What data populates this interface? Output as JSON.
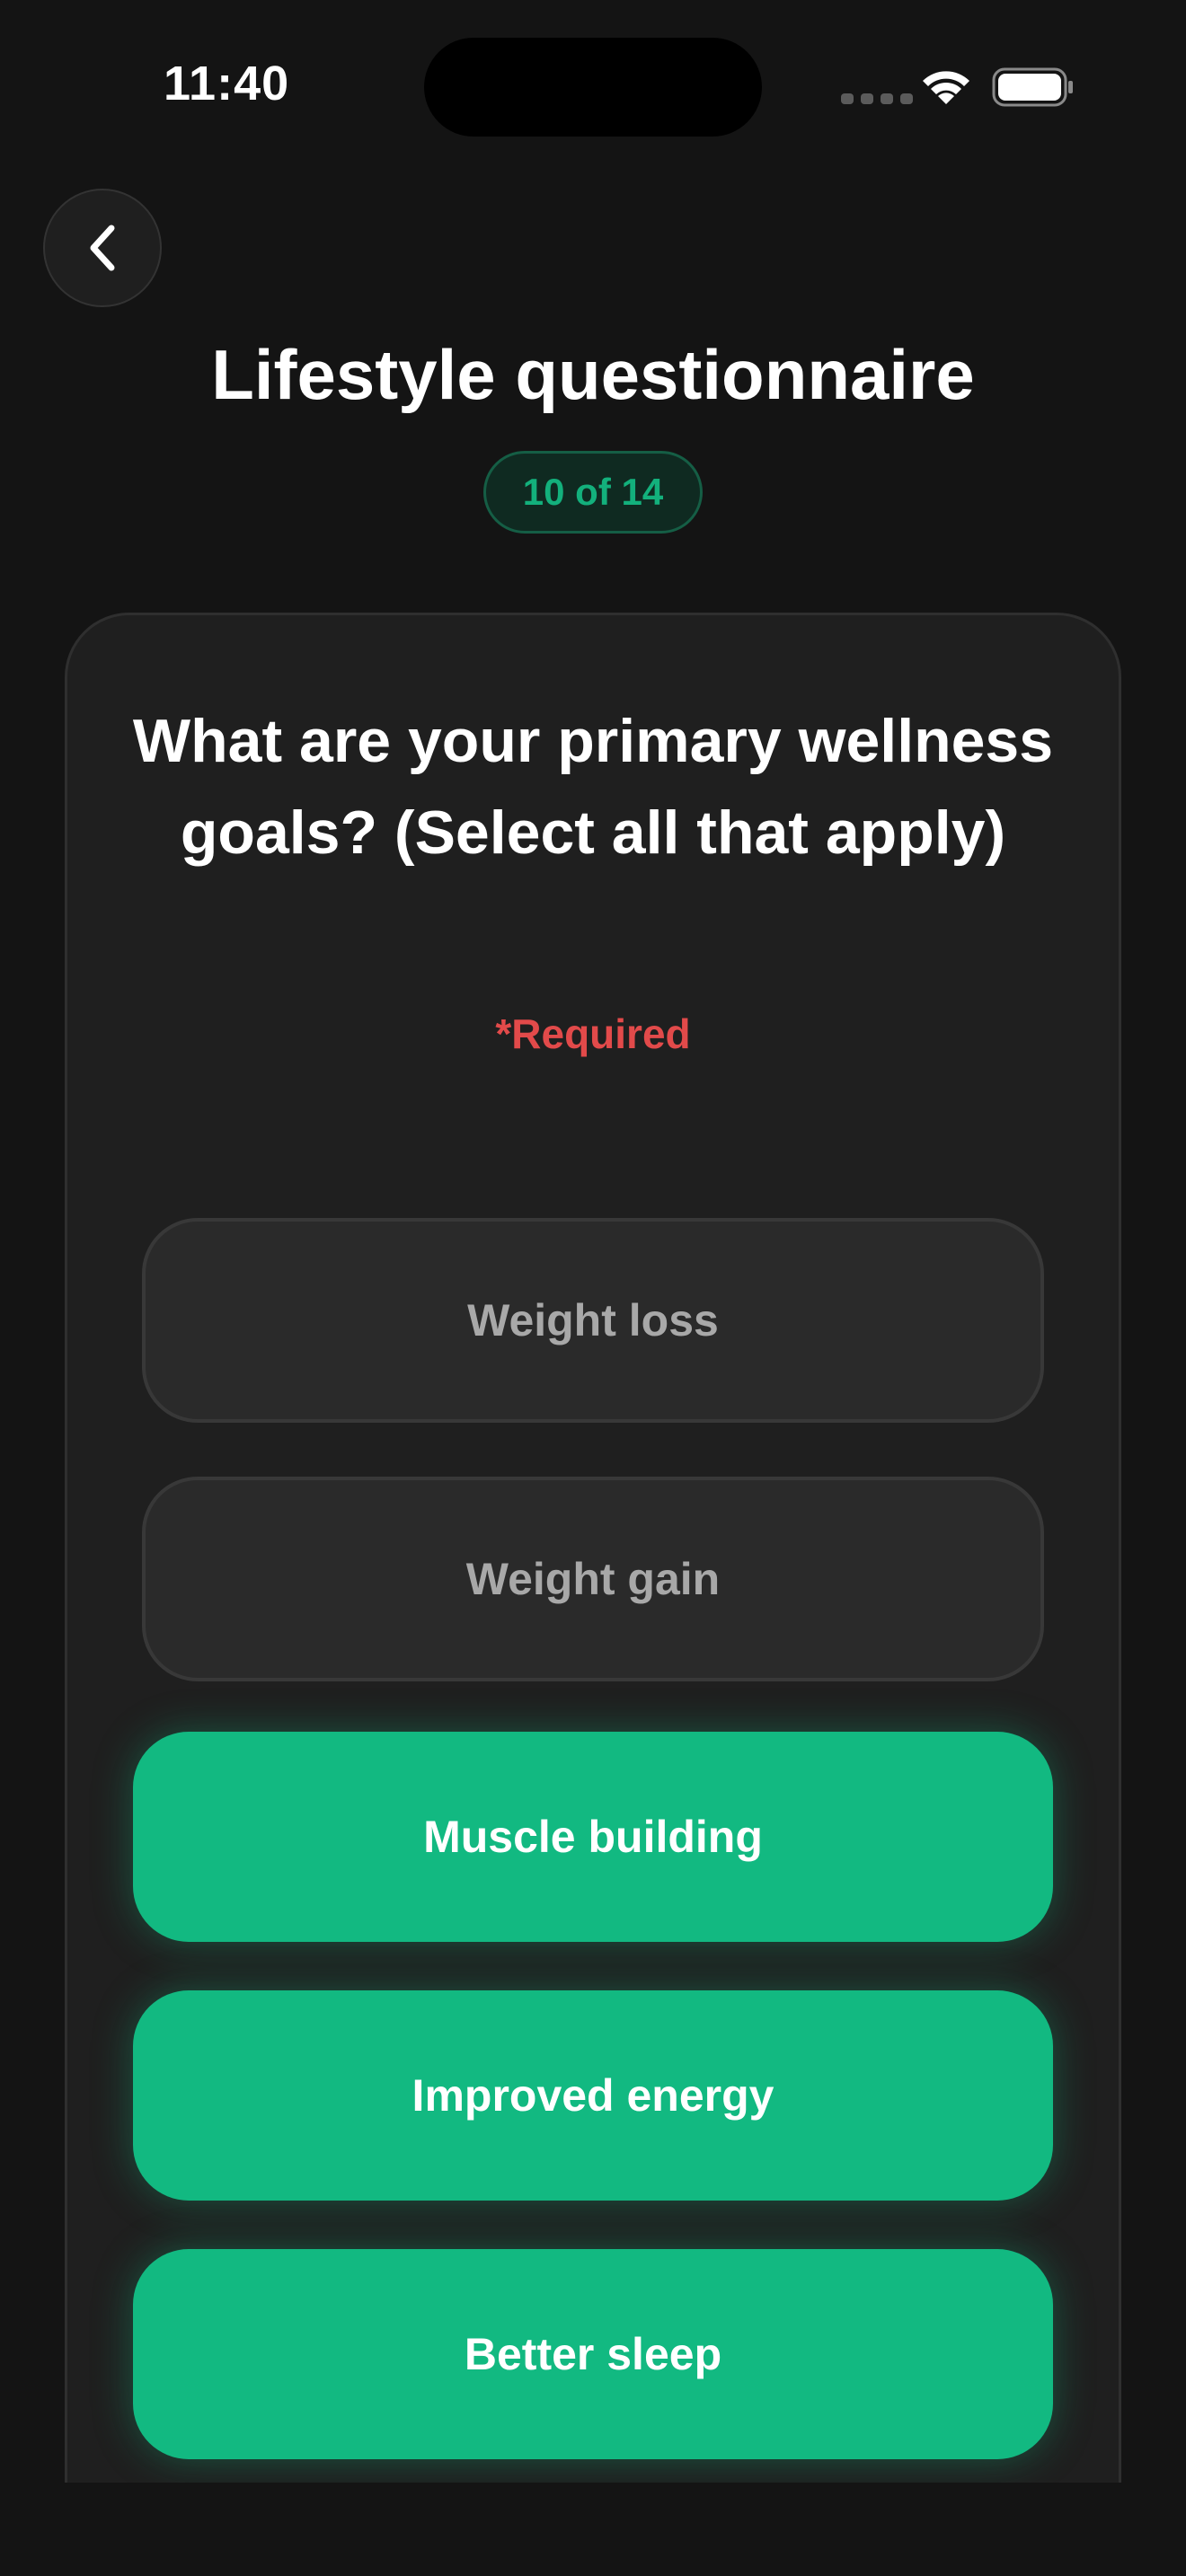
{
  "status_bar": {
    "time": "11:40"
  },
  "header": {
    "back_icon": "chevron-left-icon",
    "title": "Lifestyle questionnaire",
    "progress": "10 of 14"
  },
  "question": {
    "text": "What are your primary wellness goals? (Select all that apply)",
    "required_label": "*Required"
  },
  "options": [
    {
      "label": "Weight loss",
      "selected": false
    },
    {
      "label": "Weight gain",
      "selected": false
    },
    {
      "label": "Muscle building",
      "selected": true
    },
    {
      "label": "Improved energy",
      "selected": true
    },
    {
      "label": "Better sleep",
      "selected": true
    }
  ],
  "colors": {
    "background": "#141414",
    "card": "#1f1f1f",
    "accent": "#12b981",
    "required": "#e24a4a",
    "unselected_option": "#2a2a2a"
  }
}
